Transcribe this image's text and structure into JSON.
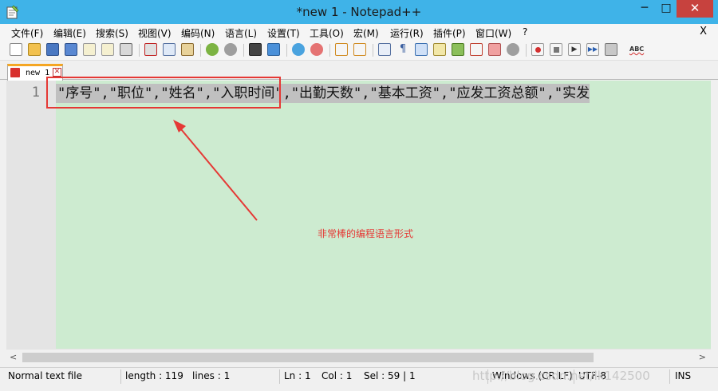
{
  "window": {
    "title": "*new 1 - Notepad++",
    "min": "─",
    "max": "□",
    "close": "✕"
  },
  "menu": {
    "items": [
      "文件(F)",
      "编辑(E)",
      "搜索(S)",
      "视图(V)",
      "编码(N)",
      "语言(L)",
      "设置(T)",
      "工具(O)",
      "宏(M)",
      "运行(R)",
      "插件(P)",
      "窗口(W)",
      "?"
    ],
    "close": "X"
  },
  "toolbar": {
    "icons": [
      "new-file-icon",
      "open-file-icon",
      "save-icon",
      "save-all-icon",
      "close-icon",
      "close-all-icon",
      "print-icon",
      "cut-icon",
      "copy-icon",
      "paste-icon",
      "undo-icon",
      "redo-icon",
      "find-icon",
      "replace-icon",
      "zoom-in-icon",
      "zoom-out-icon",
      "sync-vertical-icon",
      "sync-horizontal-icon",
      "word-wrap-icon",
      "show-all-chars-icon",
      "indent-guide-icon",
      "udl-icon",
      "doc-map-icon",
      "function-list-icon",
      "folder-workspace-icon",
      "monitor-icon",
      "record-macro-icon",
      "stop-macro-icon",
      "play-macro-icon",
      "run-macro-multiple-icon",
      "save-macro-icon",
      "spell-check-icon"
    ],
    "spell_label": "ABC"
  },
  "tab": {
    "label": "new 1",
    "close": "✕"
  },
  "editor": {
    "line_number": "1",
    "line_text": "\"序号\",\"职位\",\"姓名\",\"入职时间\",\"出勤天数\",\"基本工资\",\"应发工资总额\",\"实发"
  },
  "annotation": {
    "text": "非常棒的编程语言形式",
    "color": "#e53935"
  },
  "scroll": {
    "left": "<",
    "right": ">"
  },
  "status": {
    "file_type": "Normal text file",
    "length": "length : 119",
    "lines": "lines : 1",
    "ln": "Ln : 1",
    "col": "Col : 1",
    "sel": "Sel : 59 | 1",
    "eol": "Windows (CR LF)",
    "encoding": "UTF-8",
    "mode": "INS"
  },
  "watermark": "http://blog.csdn.net/lk142500",
  "colors": {
    "titlebar": "#3fb3e8",
    "editor_bg": "#cdebd0",
    "selection": "#c0c0c0",
    "tab_accent": "#f5a623"
  }
}
